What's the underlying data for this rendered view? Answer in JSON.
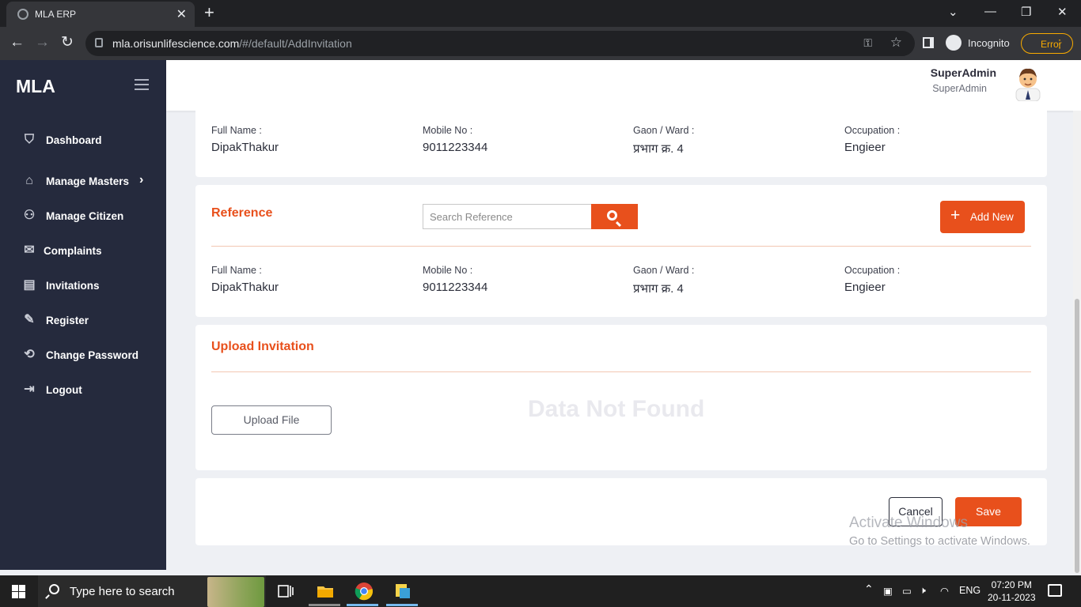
{
  "browser": {
    "tab_title": "MLA ERP",
    "url_host": "mla.orisunlifescience.com",
    "url_path": "/#/default/AddInvitation",
    "incognito_label": "Incognito",
    "error_label": "Error"
  },
  "sidebar": {
    "logo": "MLA",
    "items": [
      {
        "label": "Dashboard",
        "icon": "shield-icon"
      },
      {
        "label": "Manage Masters",
        "icon": "graduation-cap-icon"
      },
      {
        "label": "Manage Citizen",
        "icon": "users-icon"
      },
      {
        "label": "Complaints",
        "icon": "envelope-icon"
      },
      {
        "label": "Invitations",
        "icon": "document-icon"
      },
      {
        "label": "Register",
        "icon": "edit-document-icon"
      },
      {
        "label": "Change Password",
        "icon": "refresh-check-icon"
      },
      {
        "label": "Logout",
        "icon": "logout-icon"
      }
    ]
  },
  "header": {
    "user_name": "SuperAdmin",
    "user_role": "SuperAdmin"
  },
  "citizen": {
    "full_name_label": "Full Name :",
    "full_name": "DipakThakur",
    "mobile_label": "Mobile No :",
    "mobile": "9011223344",
    "ward_label": "Gaon / Ward :",
    "ward": "प्रभाग क्र. 4",
    "occupation_label": "Occupation :",
    "occupation": "Engieer"
  },
  "reference": {
    "title": "Reference",
    "search_placeholder": "Search Reference",
    "add_new_label": "Add New",
    "full_name_label": "Full Name :",
    "full_name": "DipakThakur",
    "mobile_label": "Mobile No :",
    "mobile": "9011223344",
    "ward_label": "Gaon / Ward :",
    "ward": "प्रभाग क्र. 4",
    "occupation_label": "Occupation :",
    "occupation": "Engieer"
  },
  "upload": {
    "title": "Upload Invitation",
    "upload_label": "Upload File",
    "empty_text": "Data Not Found"
  },
  "actions": {
    "cancel_label": "Cancel",
    "save_label": "Save"
  },
  "watermark": {
    "line1": "Activate Windows",
    "line2": "Go to Settings to activate Windows."
  },
  "taskbar": {
    "search_text": "Type here to search",
    "language": "ENG",
    "time": "07:20 PM",
    "date": "20-11-2023"
  },
  "colors": {
    "accent": "#e8501c",
    "sidebar_bg": "#252a3d"
  }
}
